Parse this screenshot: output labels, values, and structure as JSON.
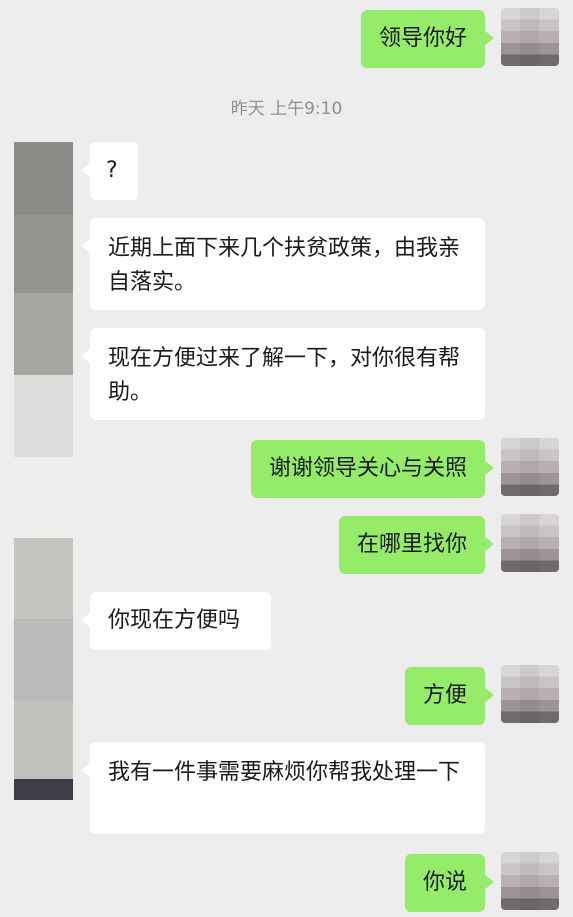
{
  "timestamp": "昨天 上午9:10",
  "messages": [
    {
      "side": "out",
      "text": "领导你好"
    },
    {
      "side": "in",
      "text": "?"
    },
    {
      "side": "in",
      "text": "近期上面下来几个扶贫政策，由我亲自落实。"
    },
    {
      "side": "in",
      "text": "现在方便过来了解一下，对你很有帮助。"
    },
    {
      "side": "out",
      "text": "谢谢领导关心与关照"
    },
    {
      "side": "out",
      "text": "在哪里找你"
    },
    {
      "side": "in",
      "text": "你现在方便吗"
    },
    {
      "side": "out",
      "text": "方便"
    },
    {
      "side": "in",
      "text": "我有一件事需要麻烦你帮我处理一下"
    },
    {
      "side": "out",
      "text": "你说"
    }
  ],
  "colors": {
    "background": "#ededed",
    "outgoing_bubble": "#95ec69",
    "incoming_bubble": "#ffffff",
    "timestamp_text": "#8f8f8f"
  }
}
